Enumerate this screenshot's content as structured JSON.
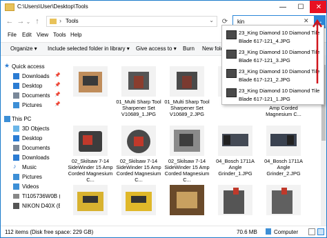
{
  "titlebar": {
    "title": "C:\\Users\\User\\Desktop\\Tools",
    "min": "—",
    "max": "☐",
    "close": "✕"
  },
  "address": {
    "back": "←",
    "forward": "→",
    "up_dropdown": "⌄",
    "up": "↑",
    "chevron": "›",
    "path": "Tools",
    "refresh": "⟳",
    "dropdown_caret": "⌄"
  },
  "search": {
    "value": "kin",
    "clear": "✕",
    "go": "→"
  },
  "menubar": {
    "items": [
      "File",
      "Edit",
      "View",
      "Tools",
      "Help"
    ]
  },
  "cmdbar": {
    "items": [
      "Organize ▾",
      "Include selected folder in library ▾",
      "Give access to ▾",
      "Burn",
      "New folder"
    ]
  },
  "navpane": {
    "items": [
      {
        "label": "Quick access",
        "icon": "star-icon",
        "color": "#2b7cd3",
        "pinned": false
      },
      {
        "label": "Downloads",
        "icon": "download-folder-icon",
        "color": "#2b7cd3",
        "pinned": true
      },
      {
        "label": "Desktop",
        "icon": "desktop-folder-icon",
        "color": "#2b7cd3",
        "pinned": true
      },
      {
        "label": "Documents",
        "icon": "documents-icon",
        "color": "#7a8899",
        "pinned": true
      },
      {
        "label": "Pictures",
        "icon": "pictures-icon",
        "color": "#3d8fd6",
        "pinned": true
      },
      {
        "label": "This PC",
        "icon": "computer-icon",
        "color": "#3d8fd6",
        "pinned": false
      },
      {
        "label": "3D Objects",
        "icon": "cube-icon",
        "color": "#6bb6e8",
        "pinned": false
      },
      {
        "label": "Desktop",
        "icon": "desktop-folder-icon",
        "color": "#2b7cd3",
        "pinned": false
      },
      {
        "label": "Documents",
        "icon": "documents-icon",
        "color": "#7a8899",
        "pinned": false
      },
      {
        "label": "Downloads",
        "icon": "download-folder-icon",
        "color": "#2b7cd3",
        "pinned": false
      },
      {
        "label": "Music",
        "icon": "music-icon",
        "color": "#2b7cd3",
        "pinned": false
      },
      {
        "label": "Pictures",
        "icon": "pictures-icon",
        "color": "#3d8fd6",
        "pinned": false
      },
      {
        "label": "Videos",
        "icon": "videos-icon",
        "color": "#3d8fd6",
        "pinned": false
      },
      {
        "label": "TI105736W0B (C:)",
        "icon": "drive-icon",
        "color": "#888888",
        "pinned": false
      },
      {
        "label": "NIKON D40X (E:)",
        "icon": "camera-drive-icon",
        "color": "#555555",
        "pinned": false
      }
    ],
    "pin_glyph": "📌"
  },
  "files": [
    {
      "caption": "",
      "thumb": "#c08d5b"
    },
    {
      "caption": "01_Multi Sharp Tool Sharpener Set V10689_1.JPG",
      "thumb": "#8a3d2e"
    },
    {
      "caption": "01_Multi Sharp Tool Sharpener Set V10689_2.JPG",
      "thumb": "#7a3a30"
    },
    {
      "caption": "",
      "thumb": "#5a6a78"
    },
    {
      "caption": "02_Skilsaw 7-14 SideWinder 15 Amp Corded Magnesium C...",
      "thumb": "#3d3d3d"
    },
    {
      "caption": "02_Skilsaw 7-14 SideWinder 15 Amp Corded Magnesium C...",
      "thumb": "#4a4a4a"
    },
    {
      "caption": "02_Skilsaw 7-14 SideWinder 15 Amp Corded Magnesium C...",
      "thumb": "#8a8a8a"
    },
    {
      "caption": "04_Bosch 1711A Angle Grinder_1.JPG",
      "thumb": "#444a55"
    },
    {
      "caption": "04_Bosch 1711A Angle Grinder_2.JPG",
      "thumb": "#3a4250"
    },
    {
      "caption": "",
      "thumb": "#d8b230"
    },
    {
      "caption": "",
      "thumb": "#e0b82a"
    },
    {
      "caption": "",
      "thumb": "#6a4a2a"
    },
    {
      "caption": "",
      "thumb": "#555555"
    },
    {
      "caption": "",
      "thumb": "#606060"
    },
    {
      "caption": "",
      "thumb": "#9a9a9a"
    }
  ],
  "partial_captions": [
    "Amp Corded",
    "Magnesium C..."
  ],
  "suggestions": [
    {
      "line1": "23_King Diamond 10 Diamond Tile",
      "line2": "Blade 617-121_4.JPG"
    },
    {
      "line1": "23_King Diamond 10 Diamond Tile",
      "line2": "Blade 617-121_3.JPG"
    },
    {
      "line1": "23_King Diamond 10 Diamond Tile",
      "line2": "Blade 617-121_2.JPG"
    },
    {
      "line1": "23_King Diamond 10 Diamond Tile",
      "line2": "Blade 617-121_1.JPG"
    }
  ],
  "status": {
    "items": "112 items (Disk free space: 229 GB)",
    "size": "70.6 MB",
    "location": "Computer"
  },
  "colors": {
    "accent": "#2a86d8",
    "annotation": "#d0151c",
    "close": "#e81123"
  }
}
